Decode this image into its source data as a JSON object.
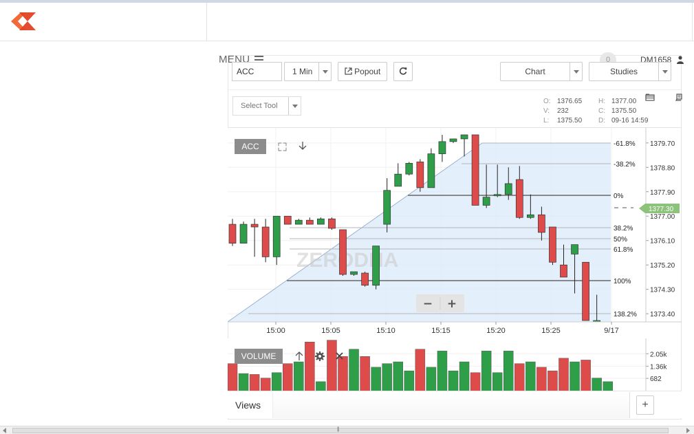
{
  "header": {
    "menu_label": "MENU",
    "notification_count": "0",
    "user_id": "DM1658"
  },
  "toolbar": {
    "symbol_value": "ACC",
    "interval_label": "1 Min",
    "popout_label": "Popout",
    "chart_label": "Chart",
    "studies_label": "Studies",
    "select_tool_label": "Select Tool"
  },
  "ohlc": {
    "o_label": "O:",
    "o_value": "1376.65",
    "h_label": "H:",
    "h_value": "1377.00",
    "v_label": "V:",
    "v_value": "232",
    "c_label": "C:",
    "c_value": "1375.50",
    "l_label": "L:",
    "l_value": "1375.50",
    "d_label": "D:",
    "d_value": "09-16 14:59"
  },
  "main_chart": {
    "label": "ACC",
    "watermark": "ZERODHA",
    "last_price_tag": "1377.30",
    "zoom_out": "−",
    "zoom_in": "+"
  },
  "volume_panel": {
    "label": "VOLUME"
  },
  "bottom": {
    "views_label": "Views",
    "add_label": "+"
  },
  "colors": {
    "up": "#2e9e49",
    "down": "#de4b4b",
    "fib_fill": "#dbe9fb",
    "price_tag": "#8cc27a",
    "brand": "#f26a3a"
  },
  "icons": [
    "logo-icon",
    "hamburger-icon",
    "user-icon",
    "external-link-icon",
    "refresh-icon",
    "fullscreen-icon",
    "arrow-down-icon",
    "arrow-up-icon",
    "gear-icon",
    "close-icon",
    "layers-icon",
    "book-icon"
  ],
  "chart_data": [
    {
      "type": "candlestick",
      "title": "ACC",
      "y_ticks": [
        "1379.70",
        "1378.80",
        "1377.90",
        "1377.00",
        "1376.10",
        "1375.20",
        "1374.30",
        "1373.40"
      ],
      "ylim": [
        1373.15,
        1380.0
      ],
      "x_ticks": [
        "15:00",
        "15:05",
        "15:10",
        "15:15",
        "15:20",
        "15:25",
        "9/17"
      ],
      "candles": [
        {
          "o": 1376.7,
          "h": 1376.9,
          "l": 1375.9,
          "c": 1376.0
        },
        {
          "o": 1376.0,
          "h": 1376.8,
          "l": 1376.0,
          "c": 1376.7
        },
        {
          "o": 1376.7,
          "h": 1376.9,
          "l": 1375.5,
          "c": 1376.6
        },
        {
          "o": 1376.6,
          "h": 1376.9,
          "l": 1375.3,
          "c": 1375.5
        },
        {
          "o": 1375.5,
          "h": 1377.0,
          "l": 1375.2,
          "c": 1377.0
        },
        {
          "o": 1377.0,
          "h": 1377.0,
          "l": 1376.7,
          "c": 1376.7
        },
        {
          "o": 1376.7,
          "h": 1376.9,
          "l": 1376.7,
          "c": 1376.85
        },
        {
          "o": 1376.85,
          "h": 1376.95,
          "l": 1376.7,
          "c": 1376.7
        },
        {
          "o": 1376.7,
          "h": 1376.95,
          "l": 1376.7,
          "c": 1376.9
        },
        {
          "o": 1376.9,
          "h": 1376.95,
          "l": 1376.5,
          "c": 1376.55
        },
        {
          "o": 1376.5,
          "h": 1376.5,
          "l": 1374.8,
          "c": 1374.85
        },
        {
          "o": 1374.85,
          "h": 1374.95,
          "l": 1374.8,
          "c": 1374.95
        },
        {
          "o": 1374.9,
          "h": 1374.95,
          "l": 1374.4,
          "c": 1374.45
        },
        {
          "o": 1374.45,
          "h": 1375.9,
          "l": 1374.3,
          "c": 1375.9
        },
        {
          "o": 1376.7,
          "h": 1378.4,
          "l": 1376.4,
          "c": 1377.95
        },
        {
          "o": 1378.1,
          "h": 1378.95,
          "l": 1378.1,
          "c": 1378.55
        },
        {
          "o": 1378.55,
          "h": 1379.0,
          "l": 1378.5,
          "c": 1378.95
        },
        {
          "o": 1379.0,
          "h": 1379.1,
          "l": 1377.9,
          "c": 1378.05
        },
        {
          "o": 1378.05,
          "h": 1379.5,
          "l": 1378.05,
          "c": 1379.3
        },
        {
          "o": 1379.3,
          "h": 1380.0,
          "l": 1379.0,
          "c": 1379.75
        },
        {
          "o": 1379.75,
          "h": 1379.85,
          "l": 1379.7,
          "c": 1379.85
        },
        {
          "o": 1379.85,
          "h": 1379.95,
          "l": 1379.2,
          "c": 1380.0
        },
        {
          "o": 1380.0,
          "h": 1380.0,
          "l": 1377.4,
          "c": 1377.4
        },
        {
          "o": 1377.4,
          "h": 1378.9,
          "l": 1377.3,
          "c": 1377.7
        },
        {
          "o": 1377.75,
          "h": 1378.9,
          "l": 1377.7,
          "c": 1377.8
        },
        {
          "o": 1377.8,
          "h": 1378.8,
          "l": 1377.6,
          "c": 1378.2
        },
        {
          "o": 1378.35,
          "h": 1378.85,
          "l": 1376.9,
          "c": 1376.95
        },
        {
          "o": 1376.95,
          "h": 1377.8,
          "l": 1376.9,
          "c": 1377.05
        },
        {
          "o": 1377.05,
          "h": 1377.35,
          "l": 1376.1,
          "c": 1376.4
        },
        {
          "o": 1376.6,
          "h": 1376.6,
          "l": 1375.2,
          "c": 1375.3
        },
        {
          "o": 1375.2,
          "h": 1375.95,
          "l": 1374.75,
          "c": 1374.75
        },
        {
          "o": 1375.6,
          "h": 1375.9,
          "l": 1374.15,
          "c": 1375.95
        },
        {
          "o": 1375.3,
          "h": 1375.3,
          "l": 1373.15,
          "c": 1373.15
        },
        {
          "o": 1373.15,
          "h": 1374.1,
          "l": 1373.1,
          "c": 1373.15
        }
      ],
      "fibonacci_levels": [
        "-61.8%",
        "-38.2%",
        "0%",
        "38.2%",
        "50%",
        "61.8%",
        "100%",
        "138.2%"
      ]
    },
    {
      "type": "bar",
      "title": "VOLUME",
      "y_ticks": [
        "2.05k",
        "1.36k",
        "682"
      ],
      "values": [
        1500,
        950,
        900,
        700,
        1000,
        1500,
        1600,
        2700,
        500,
        2800,
        1900,
        2300,
        1900,
        1300,
        1500,
        1600,
        1100,
        2300,
        1300,
        2200,
        1100,
        1600,
        1000,
        2200,
        1000,
        2200,
        1500,
        1600,
        1300,
        1100,
        1800,
        1600,
        1700,
        700,
        500
      ]
    }
  ]
}
